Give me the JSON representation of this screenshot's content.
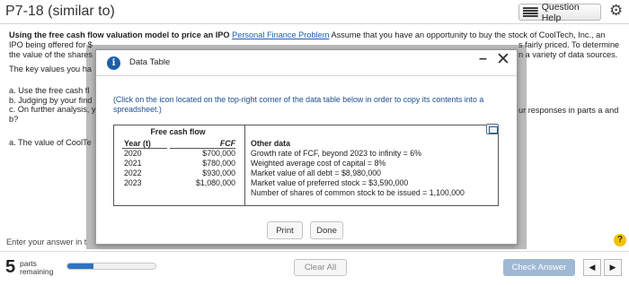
{
  "header": {
    "title": "P7-18 (similar to)",
    "question_help": "Question Help",
    "gear_icon": "gear-icon"
  },
  "question": {
    "lead_bold": "Using the free cash flow valuation model to price an IPO",
    "link": "Personal Finance Problem",
    "line1_tail": "Assume that you have an opportunity to buy the stock of CoolTech, Inc., an",
    "line2_left": "IPO being offered for $",
    "line2_right": "s fairly priced.  To determine",
    "line3_left": "the value of the shares",
    "line3_right": "n a variety of data sources.",
    "key_values": "The key values you ha",
    "part_a": "a.  Use the free cash fl",
    "part_b": "b.  Judging by your find",
    "part_c": "c.  On further analysis, y",
    "part_c_end": "b?",
    "right_response": "ur responses in parts a and",
    "part_a_answer": "a.  The value of CoolTe",
    "enter_answer": "Enter your answer in t",
    "help": "?"
  },
  "modal": {
    "title": "Data Table",
    "minimize": "–",
    "close": "✕",
    "info_icon": "info-icon",
    "note": "(Click on the icon located on the top-right corner of the data table below in order to copy its contents into a spreadsheet.)",
    "table": {
      "caption": "Free cash flow",
      "year_header": "Year (t)",
      "fcf_header": "FCF",
      "rows": [
        {
          "year": "2020",
          "fcf": "$700,000"
        },
        {
          "year": "2021",
          "fcf": "$780,000"
        },
        {
          "year": "2022",
          "fcf": "$930,000"
        },
        {
          "year": "2023",
          "fcf": "$1,080,000"
        }
      ],
      "other_header": "Other data",
      "other": [
        "Growth rate of FCF, beyond 2023 to infinity = 6%",
        "Weighted average cost of capital = 8%",
        "Market value of all debt = $8,980,000",
        "Market value of preferred stock = $3,590,000",
        "Number of shares of common stock to be issued = 1,100,000"
      ]
    },
    "print": "Print",
    "done": "Done"
  },
  "footer": {
    "parts_count": "5",
    "parts_line1": "parts",
    "parts_line2": "remaining",
    "progress_fraction": 0.3,
    "clear_all": "Clear All",
    "check_answer": "Check Answer",
    "prev": "◀",
    "next": "▶"
  },
  "colors": {
    "accent": "#1d5fa8",
    "progress": "#2f73c0",
    "check_answer_bg": "#9fb8d4",
    "help_badge": "#f2c200"
  }
}
